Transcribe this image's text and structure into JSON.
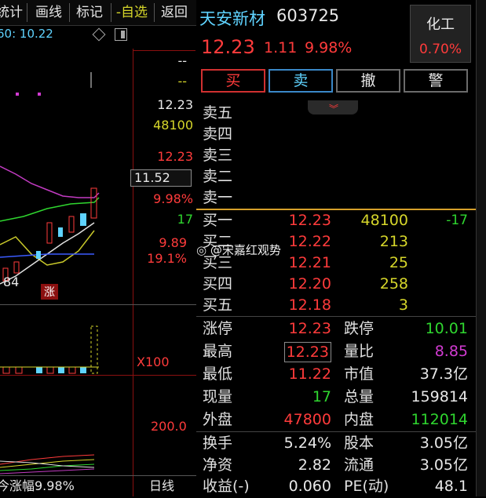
{
  "toolbar": {
    "items": [
      "统计",
      "画线",
      "标记",
      "-自选",
      "返回"
    ]
  },
  "chart": {
    "ma_label": "60: 10.22",
    "right_axis": {
      "dash1": "--",
      "dash2": "--",
      "price_high": "12.23",
      "vol_top": "48100",
      "limit_up": "12.23",
      "current_box": "11.52",
      "pct_top": "9.98%",
      "small_val": "17",
      "price_low": "9.89",
      "pct_low": "19.1%"
    },
    "low_label": "84",
    "zhang_badge": "涨",
    "vol_multiplier": "X100",
    "indicator_value": "200.0",
    "bottom_status": "今涨幅9.98%",
    "period": "日线"
  },
  "stock": {
    "name": "天安新材",
    "code": "603725",
    "price": "12.23",
    "change": "1.11",
    "change_pct": "9.98%",
    "sector": "化工",
    "sector_pct": "0.70%"
  },
  "actions": {
    "buy": "买",
    "sell": "卖",
    "cancel": "撤",
    "alert": "警"
  },
  "order_book": {
    "asks": [
      {
        "label": "卖五",
        "price": "",
        "vol": ""
      },
      {
        "label": "卖四",
        "price": "",
        "vol": ""
      },
      {
        "label": "卖三",
        "price": "",
        "vol": ""
      },
      {
        "label": "卖二",
        "price": "",
        "vol": ""
      },
      {
        "label": "卖一",
        "price": "",
        "vol": ""
      }
    ],
    "bids": [
      {
        "label": "买一",
        "price": "12.23",
        "vol": "48100",
        "chg": "-17"
      },
      {
        "label": "买二",
        "price": "12.22",
        "vol": "213",
        "chg": ""
      },
      {
        "label": "买三",
        "price": "12.21",
        "vol": "25",
        "chg": ""
      },
      {
        "label": "买四",
        "price": "12.20",
        "vol": "258",
        "chg": ""
      },
      {
        "label": "买五",
        "price": "12.18",
        "vol": "3",
        "chg": ""
      }
    ]
  },
  "stats": [
    {
      "l1": "涨停",
      "v1": "12.23",
      "l2": "跌停",
      "v2": "10.01"
    },
    {
      "l1": "最高",
      "v1": "12.23",
      "l2": "量比",
      "v2": "8.85"
    },
    {
      "l1": "最低",
      "v1": "11.22",
      "l2": "市值",
      "v2": "37.3亿"
    },
    {
      "l1": "现量",
      "v1": "17",
      "l2": "总量",
      "v2": "159814"
    },
    {
      "l1": "外盘",
      "v1": "47800",
      "l2": "内盘",
      "v2": "112014"
    }
  ],
  "stats2": [
    {
      "l1": "换手",
      "v1": "5.24%",
      "l2": "股本",
      "v2": "3.05亿"
    },
    {
      "l1": "净资",
      "v1": "2.82",
      "l2": "流通",
      "v2": "3.05亿"
    },
    {
      "l1": "收益(-)",
      "v1": "0.060",
      "l2": "PE(动)",
      "v2": "48.1"
    }
  ],
  "watermark": "@宋嘉红观势"
}
